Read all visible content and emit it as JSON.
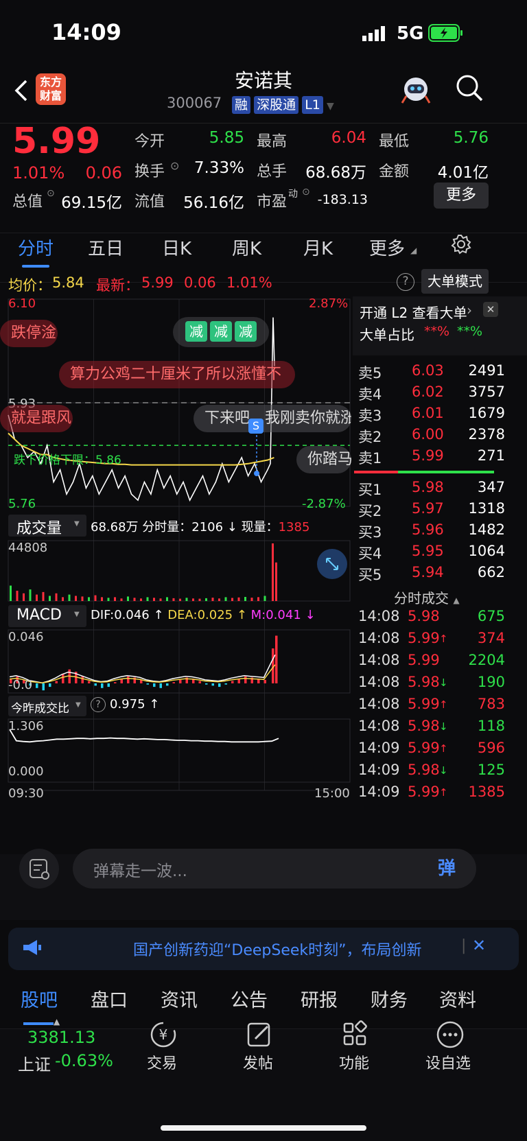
{
  "status_bar": {
    "time": "14:09",
    "network": "5G"
  },
  "header": {
    "logo_line1": "东方",
    "logo_line2": "财富",
    "title": "安诺其",
    "code": "300067",
    "badges": [
      "融",
      "深股通",
      "L1"
    ]
  },
  "quote": {
    "price": "5.99",
    "change_pct": "1.01%",
    "change": "0.06",
    "open_label": "今开",
    "open": "5.85",
    "high_label": "最高",
    "high": "6.04",
    "low_label": "最低",
    "low": "5.76",
    "turnover_label": "换手",
    "turnover": "7.33%",
    "volume_label": "总手",
    "volume": "68.68万",
    "amount_label": "金额",
    "amount": "4.01亿",
    "mktcap_label": "总值",
    "mktcap": "69.15亿",
    "float_label": "流值",
    "float": "56.16亿",
    "pe_label": "市盈",
    "pe_sup": "动",
    "pe": "-183.13",
    "more_label": "更多"
  },
  "period_tabs": [
    "分时",
    "五日",
    "日K",
    "周K",
    "月K",
    "更多"
  ],
  "chart_header": {
    "avg_label": "均价：",
    "avg": "5.84",
    "latest_label": "最新：",
    "latest": "5.99",
    "latest_change": "0.06",
    "latest_pct": "1.01%",
    "mode_button": "大单模式"
  },
  "chart_data": [
    {
      "type": "line",
      "title": "分时",
      "ylim": [
        5.76,
        6.1
      ],
      "y_tick_labels_left": [
        "6.10",
        "5.93",
        "5.76"
      ],
      "y_tick_labels_right": [
        "2.87%",
        "-2.87%"
      ],
      "x_tick_labels": [
        "09:30",
        "15:00"
      ],
      "reference_line": {
        "label": "5.93"
      },
      "lower_limit_line": {
        "label": "跌下价格下限：5.86",
        "value": 5.86
      },
      "series": [
        {
          "color": "#ffffff",
          "values": [
            5.91,
            5.87,
            5.86,
            5.84,
            5.85,
            5.83,
            5.86,
            5.8,
            5.82,
            5.78,
            5.8,
            5.83,
            5.79,
            5.81,
            5.78,
            5.8,
            5.82,
            5.79,
            5.81,
            5.78,
            5.77,
            5.8,
            5.78,
            5.82,
            5.79,
            5.81,
            5.78,
            5.8,
            5.77,
            5.79,
            5.81,
            5.78,
            5.8,
            5.83,
            5.8,
            5.82,
            5.84,
            5.81,
            5.83,
            5.8,
            5.82,
            6.07
          ]
        },
        {
          "color": "#f5d74a",
          "values": [
            5.88,
            5.87,
            5.86,
            5.855,
            5.85,
            5.845,
            5.845,
            5.84,
            5.838,
            5.836,
            5.835,
            5.834,
            5.833,
            5.832,
            5.831,
            5.83,
            5.83,
            5.829,
            5.829,
            5.828,
            5.828,
            5.828,
            5.828,
            5.828,
            5.828,
            5.828,
            5.828,
            5.828,
            5.828,
            5.828,
            5.828,
            5.828,
            5.828,
            5.828,
            5.828,
            5.828,
            5.829,
            5.83,
            5.832,
            5.834,
            5.836,
            5.84
          ]
        }
      ],
      "annotations": [
        "S"
      ]
    },
    {
      "type": "bar",
      "title": "成交量",
      "y_tick_labels": [
        "44808"
      ],
      "values": [
        12000,
        8000,
        6000,
        9000,
        5000,
        7000,
        4000,
        6000,
        3000,
        5000,
        4000,
        3500,
        3000,
        4500,
        3000,
        2500,
        3000,
        2000,
        3500,
        2500,
        2000,
        3000,
        2500,
        2000,
        3000,
        2200,
        1800,
        2500,
        2000,
        1800,
        2200,
        2600,
        2000,
        3000,
        2400,
        2800,
        3200,
        2600,
        3000,
        4000,
        44808,
        30000
      ]
    },
    {
      "type": "bar",
      "title": "MACD",
      "y_tick_labels": [
        "0.046",
        "-0.0"
      ],
      "dif": "0.046",
      "dea": "0.025",
      "m": "0.041",
      "values": [
        0.004,
        0.006,
        0.003,
        -0.002,
        -0.004,
        -0.006,
        -0.003,
        0.002,
        0.008,
        0.012,
        0.01,
        0.006,
        0.002,
        -0.002,
        -0.004,
        -0.003,
        0.001,
        0.004,
        0.006,
        0.005,
        0.003,
        -0.001,
        -0.003,
        -0.004,
        -0.002,
        0.001,
        0.003,
        0.005,
        0.004,
        0.002,
        -0.001,
        -0.002,
        -0.003,
        -0.001,
        0.002,
        0.004,
        0.006,
        0.005,
        0.004,
        0.003,
        0.03,
        0.041
      ]
    },
    {
      "type": "line",
      "title": "今昨成交比",
      "y_tick_labels": [
        "1.306",
        "0.000"
      ],
      "current": "0.975",
      "values": [
        1.25,
        0.96,
        0.94,
        0.93,
        0.95,
        0.96,
        0.98,
        1.0,
        1.0,
        1.01,
        1.02,
        1.02,
        1.01,
        1.02,
        1.02,
        1.03,
        1.02,
        1.02,
        1.01,
        1.0,
        1.01,
        1.0,
        0.99,
        0.99,
        0.98,
        0.97,
        0.97,
        0.96,
        0.96,
        0.95,
        0.95,
        0.94,
        0.94,
        0.93,
        0.93,
        0.93,
        0.93,
        0.93,
        0.94,
        0.95,
        1.02
      ]
    }
  ],
  "sub_headers": {
    "vol_label": "成交量",
    "vol_total": "68.68万",
    "vol_min_label": "分时量：",
    "vol_min": "2106",
    "vol_now_label": "现量：",
    "vol_now": "1385",
    "macd_label": "MACD",
    "dif_label": "DIF:",
    "dif": "0.046",
    "dea_label": "DEA:",
    "dea": "0.025",
    "m_label": "M:",
    "m": "0.041",
    "ratio_label": "今昨成交比",
    "ratio": "0.975"
  },
  "danmaku": [
    {
      "text": "跌停淦"
    },
    {
      "text": "算力公鸡二十厘米了所以涨懂不"
    },
    {
      "text": "就是跟风"
    },
    {
      "text": "下来吧，我刚卖你就涨"
    },
    {
      "text": "你踏马"
    }
  ],
  "reduce_badges": [
    "减",
    "减",
    "减"
  ],
  "orderbook": {
    "promo": "开通 L2 查看大单",
    "big_ratio_label": "大单占比",
    "red_ratio": "**%",
    "green_ratio": "**%",
    "asks": [
      {
        "label": "卖5",
        "price": "6.03",
        "vol": "2491"
      },
      {
        "label": "卖4",
        "price": "6.02",
        "vol": "3757"
      },
      {
        "label": "卖3",
        "price": "6.01",
        "vol": "1679"
      },
      {
        "label": "卖2",
        "price": "6.00",
        "vol": "2378"
      },
      {
        "label": "卖1",
        "price": "5.99",
        "vol": "271"
      }
    ],
    "bids": [
      {
        "label": "买1",
        "price": "5.98",
        "vol": "347"
      },
      {
        "label": "买2",
        "price": "5.97",
        "vol": "1318"
      },
      {
        "label": "买3",
        "price": "5.96",
        "vol": "1482"
      },
      {
        "label": "买4",
        "price": "5.95",
        "vol": "1064"
      },
      {
        "label": "买5",
        "price": "5.94",
        "vol": "662"
      }
    ],
    "ticks_label": "分时成交",
    "ticks": [
      {
        "time": "14:08",
        "price": "5.98",
        "arrow": "",
        "vol": "675",
        "vcolor": "green"
      },
      {
        "time": "14:08",
        "price": "5.99",
        "arrow": "↑",
        "vol": "374",
        "vcolor": "red"
      },
      {
        "time": "14:08",
        "price": "5.99",
        "arrow": "",
        "vol": "2204",
        "vcolor": "green"
      },
      {
        "time": "14:08",
        "price": "5.98",
        "arrow": "↓",
        "vol": "190",
        "vcolor": "green"
      },
      {
        "time": "14:08",
        "price": "5.99",
        "arrow": "↑",
        "vol": "783",
        "vcolor": "red"
      },
      {
        "time": "14:08",
        "price": "5.98",
        "arrow": "↓",
        "vol": "118",
        "vcolor": "green"
      },
      {
        "time": "14:09",
        "price": "5.99",
        "arrow": "↑",
        "vol": "596",
        "vcolor": "red"
      },
      {
        "time": "14:09",
        "price": "5.98",
        "arrow": "↓",
        "vol": "125",
        "vcolor": "green"
      },
      {
        "time": "14:09",
        "price": "5.99",
        "arrow": "↑",
        "vol": "1385",
        "vcolor": "red"
      }
    ]
  },
  "danmu_input": {
    "placeholder": "弹幕走一波...",
    "send_icon_label": "弹"
  },
  "news_banner": {
    "text": "国产创新药迎“DeepSeek时刻”，布局创新"
  },
  "bottom_tabs": [
    "股吧",
    "盘口",
    "资讯",
    "公告",
    "研报",
    "财务",
    "资料"
  ],
  "dock": {
    "index_value": "3381.13",
    "index_name": "上证",
    "index_change": "-0.63%",
    "items": [
      "交易",
      "发帖",
      "功能",
      "设自选"
    ]
  },
  "colors": {
    "up": "#ff2d3c",
    "down": "#2ee04a",
    "accent": "#3f8cff",
    "avg_line": "#f5d74a"
  }
}
